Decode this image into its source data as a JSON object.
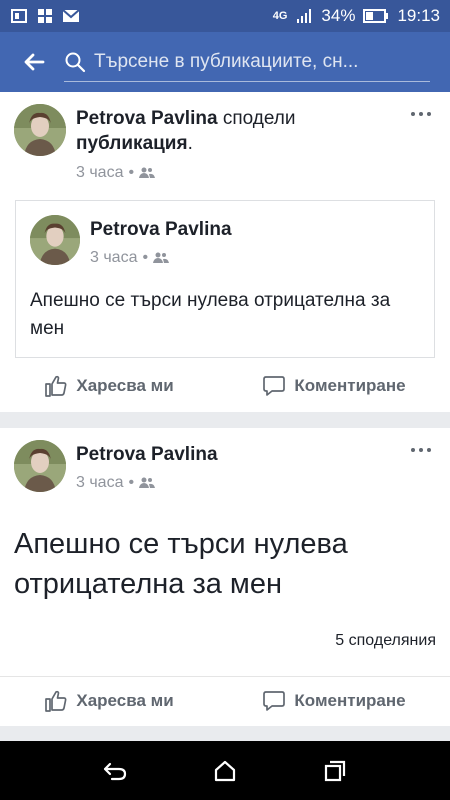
{
  "status_bar": {
    "network": "4G",
    "battery": "34%",
    "time": "19:13"
  },
  "search": {
    "placeholder": "Търсене в публикациите, сн..."
  },
  "post1": {
    "author": "Petrova Pavlina",
    "shared_verb": "сподели",
    "shared_object": "публикация",
    "time": "3 часа",
    "shared_post": {
      "author": "Petrova Pavlina",
      "time": "3 часа",
      "text": "Апешно се търси нулева отрицателна за мен"
    },
    "like_label": "Харесва ми",
    "comment_label": "Коментиране"
  },
  "post2": {
    "author": "Petrova Pavlina",
    "time": "3 часа",
    "text": "Апешно се търси нулева отрицателна за мен",
    "shares": "5 споделяния",
    "like_label": "Харесва ми",
    "comment_label": "Коментиране"
  },
  "colors": {
    "brand": "#4267b2",
    "status_bar": "#38579a",
    "feed_bg": "#e9ebee"
  }
}
